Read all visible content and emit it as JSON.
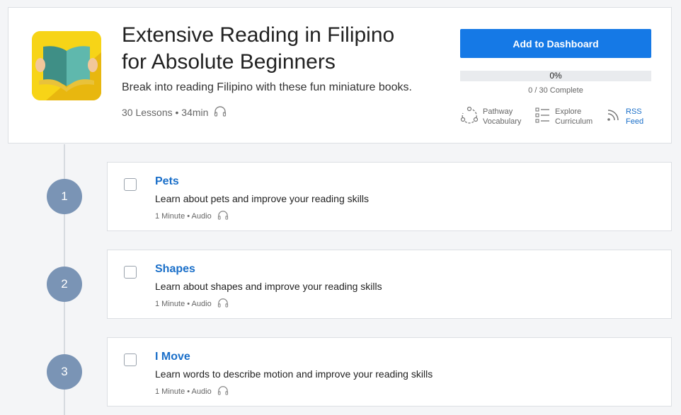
{
  "course": {
    "title_line1": "Extensive Reading in Filipino",
    "title_line2": "for Absolute Beginners",
    "subtitle": "Break into reading Filipino with these fun miniature books.",
    "meta": "30 Lessons • 34min",
    "add_button": "Add to Dashboard",
    "progress": {
      "percent_label": "0%",
      "value": 0,
      "complete_label": "0 / 30 Complete"
    },
    "links": {
      "pathway": {
        "line1": "Pathway",
        "line2": "Vocabulary"
      },
      "explore": {
        "line1": "Explore",
        "line2": "Curriculum"
      },
      "rss": {
        "line1": "RSS",
        "line2": "Feed"
      }
    }
  },
  "lessons": [
    {
      "number": "1",
      "title": "Pets",
      "description": "Learn about pets and improve your reading skills",
      "meta": "1 Minute • Audio"
    },
    {
      "number": "2",
      "title": "Shapes",
      "description": "Learn about shapes and improve your reading skills",
      "meta": "1 Minute • Audio"
    },
    {
      "number": "3",
      "title": "I Move",
      "description": "Learn words to describe motion and improve your reading skills",
      "meta": "1 Minute • Audio"
    }
  ],
  "colors": {
    "accent": "#1579e6",
    "link": "#1a6fc9",
    "step_circle": "#7a94b5",
    "cover_bg": "#f7d417"
  },
  "icons": [
    "book-cover-icon",
    "headphones-icon",
    "pathway-icon",
    "curriculum-list-icon",
    "rss-icon"
  ]
}
